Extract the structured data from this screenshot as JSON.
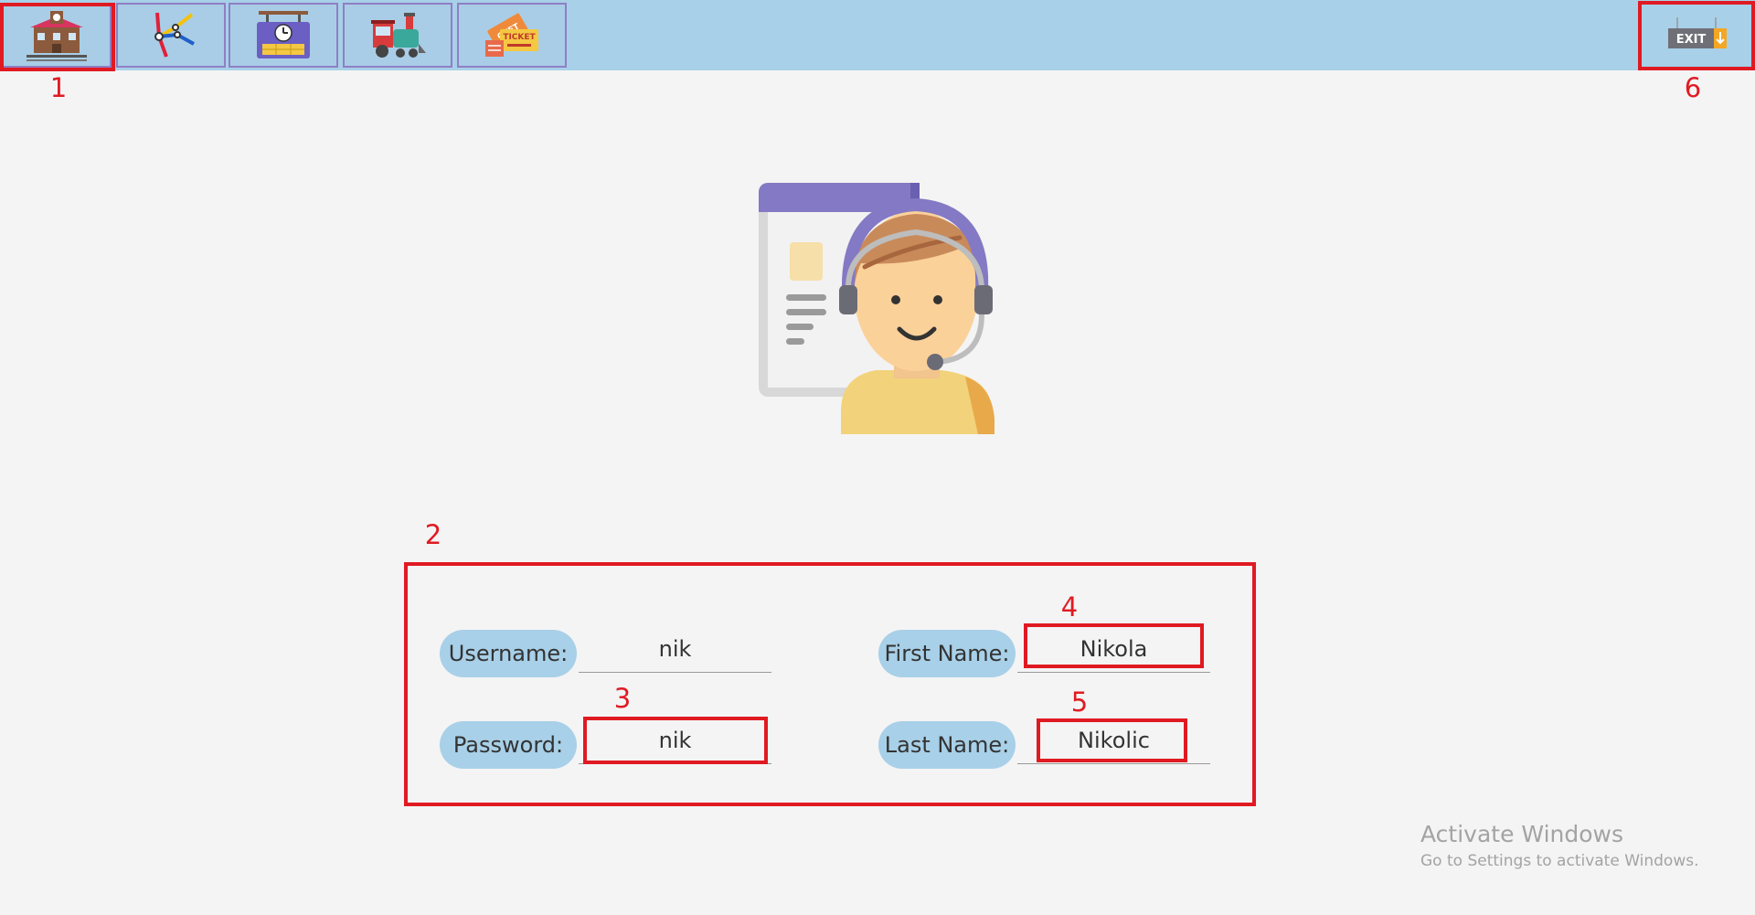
{
  "toolbar": {
    "buttons": [
      {
        "icon": "train-station-icon"
      },
      {
        "icon": "railway-map-icon"
      },
      {
        "icon": "timetable-clock-icon"
      },
      {
        "icon": "locomotive-icon"
      },
      {
        "icon": "ticket-icon"
      }
    ],
    "exit_label": "EXIT",
    "exit_icon": "exit-sign-icon"
  },
  "markers": {
    "m1": "1",
    "m2": "2",
    "m3": "3",
    "m4": "4",
    "m5": "5",
    "m6": "6"
  },
  "profile": {
    "avatar_icon": "customer-support-agent-icon",
    "username_label": "Username:",
    "username_value": "nik",
    "password_label": "Password:",
    "password_value": "nik",
    "first_name_label": "First Name:",
    "first_name_value": "Nikola",
    "last_name_label": "Last Name:",
    "last_name_value": "Nikolic"
  },
  "watermark": {
    "title": "Activate Windows",
    "subtitle": "Go to Settings to activate Windows."
  },
  "colors": {
    "toolbar_bg": "#a8d0e8",
    "label_pill": "#a8d0e8",
    "annotation_red": "#e01a22",
    "background": "#f4f4f4"
  }
}
